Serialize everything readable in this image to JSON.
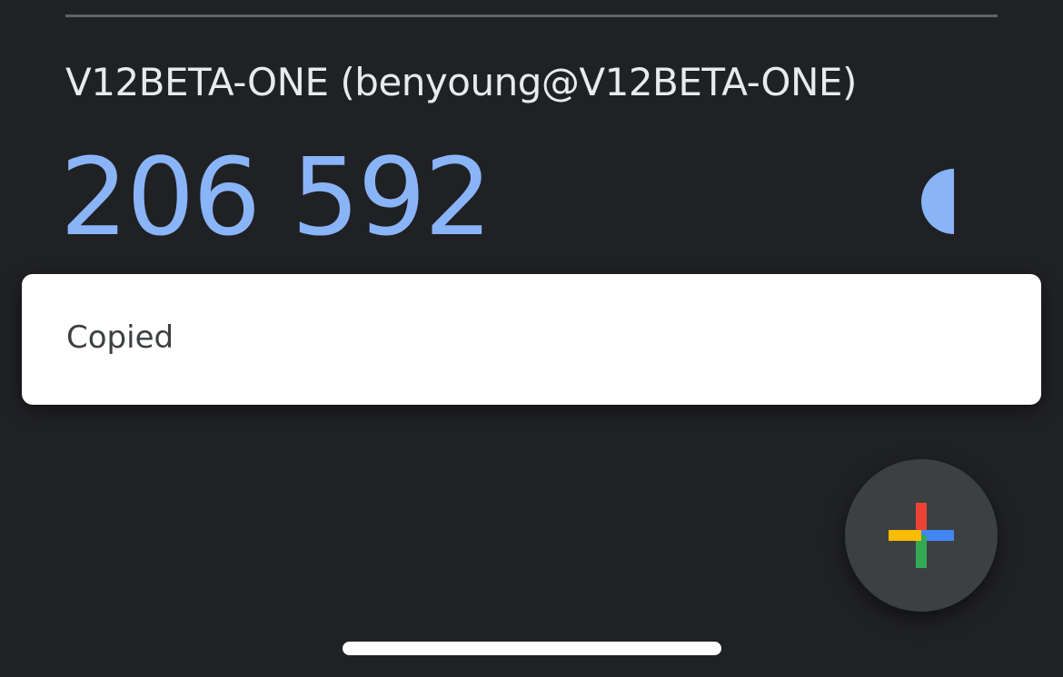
{
  "account": {
    "title": "V12BETA-ONE (benyoung@V12BETA-ONE)",
    "code": "206 592"
  },
  "timer": {
    "icon": "countdown-timer-icon",
    "remaining_fraction": 0.5,
    "color": "#8ab4f8"
  },
  "snackbar": {
    "message": "Copied"
  },
  "fab": {
    "icon": "add-icon",
    "colors": {
      "red": "#ea4335",
      "blue": "#4285f4",
      "green": "#34a853",
      "yellow": "#fbbc04"
    }
  },
  "colors": {
    "background": "#202124",
    "accent": "#8ab4f8",
    "title_text": "#e8eaed"
  }
}
